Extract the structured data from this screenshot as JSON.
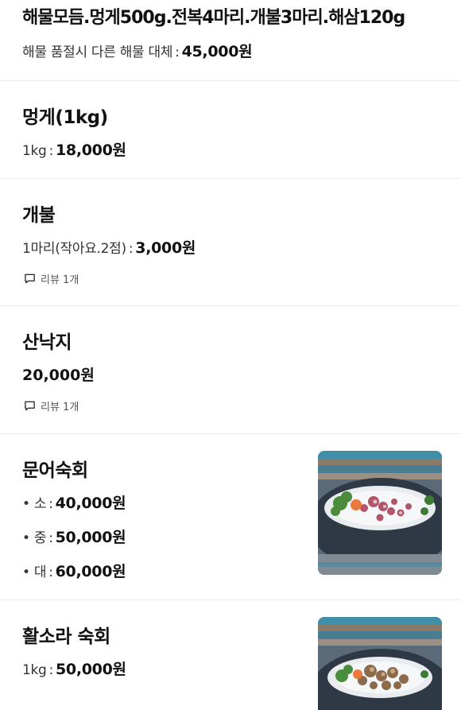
{
  "items": [
    {
      "name": "해물모듬.멍게500g.전복4마리.개불3마리.해삼120g",
      "option": "해물 품절시 다른 해물 대체",
      "price": "45,000원"
    },
    {
      "name": "멍게(1kg)",
      "option": "1kg",
      "price": "18,000원"
    },
    {
      "name": "개불",
      "option": "1마리(작아요.2점)",
      "price": "3,000원",
      "review": "리뷰 1개"
    },
    {
      "name": "산낙지",
      "price": "20,000원",
      "review": "리뷰 1개"
    },
    {
      "name": "문어숙회",
      "options": [
        {
          "label": "소",
          "price": "40,000원"
        },
        {
          "label": "중",
          "price": "50,000원"
        },
        {
          "label": "대",
          "price": "60,000원"
        }
      ],
      "image_icon": "octopus-dish-photo"
    },
    {
      "name": "활소라 숙회",
      "option": "1kg",
      "price": "50,000원",
      "image_icon": "conch-dish-photo"
    }
  ],
  "colors": {
    "divider": "#ececec",
    "text": "#111111",
    "subtext": "#555555"
  }
}
